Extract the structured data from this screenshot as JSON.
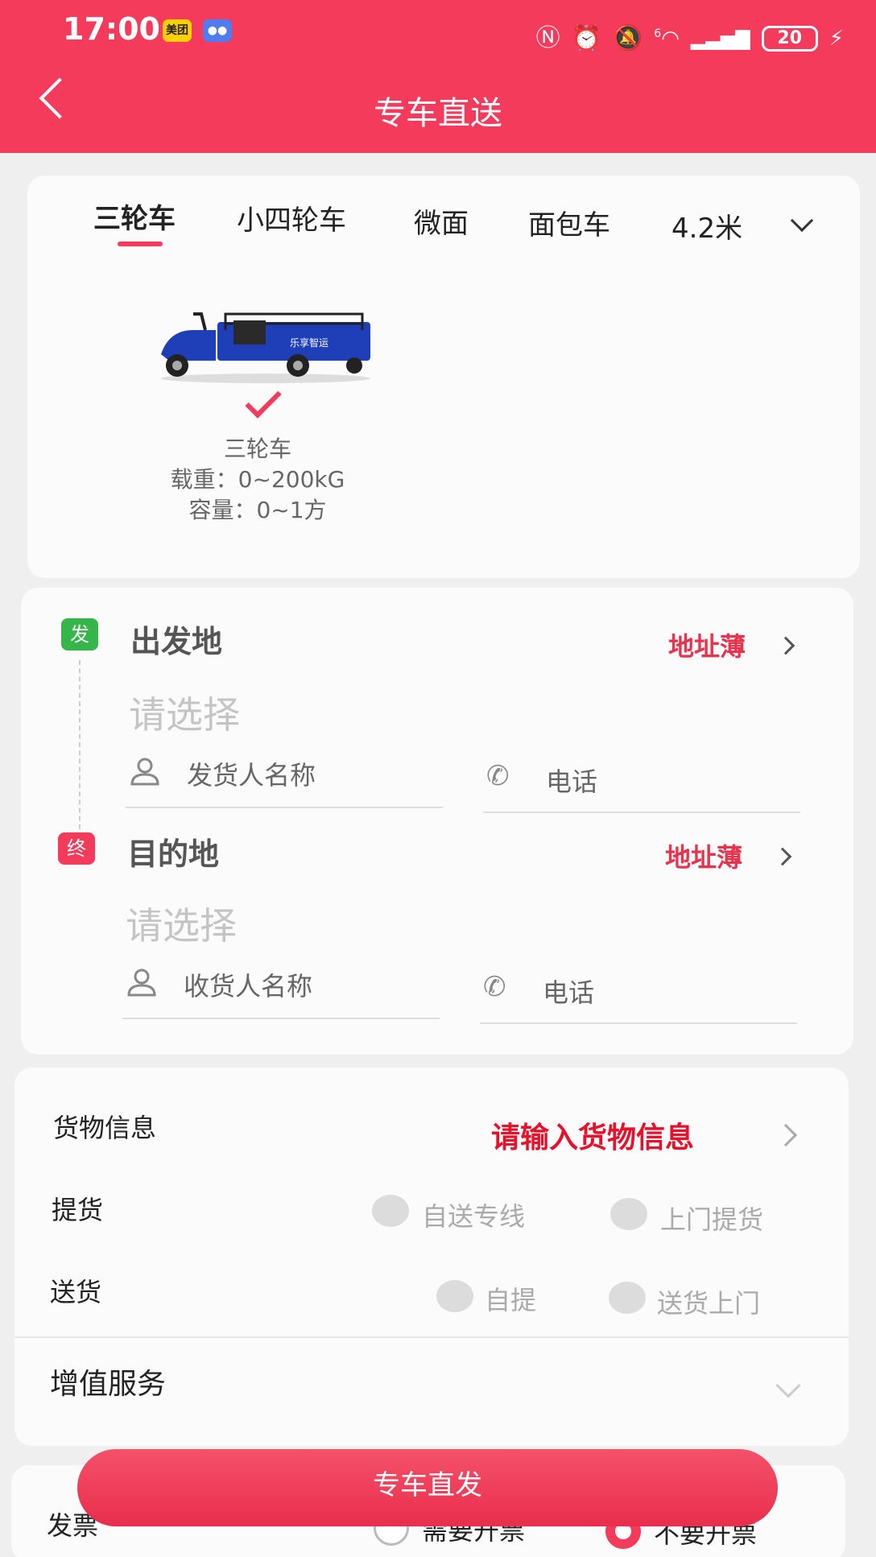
{
  "status_bar": {
    "time": "17:00",
    "app_icon_1": "美团",
    "app_icon_2": "chat-bubble",
    "battery": "20",
    "signal_label": "6"
  },
  "header": {
    "title": "专车直送"
  },
  "vehicle_tabs": [
    {
      "label": "三轮车",
      "active": true
    },
    {
      "label": "小四轮车",
      "active": false
    },
    {
      "label": "微面",
      "active": false
    },
    {
      "label": "面包车",
      "active": false
    },
    {
      "label": "4.2米",
      "active": false
    }
  ],
  "vehicle": {
    "name": "三轮车",
    "load": "载重：0~200kG",
    "capacity": "容量：0~1方",
    "image_text": "乐享智运"
  },
  "origin": {
    "badge": "发",
    "title": "出发地",
    "address_book": "地址薄",
    "placeholder": "请选择",
    "name_placeholder": "发货人名称",
    "phone_placeholder": "电话"
  },
  "destination": {
    "badge": "终",
    "title": "目的地",
    "address_book": "地址薄",
    "placeholder": "请选择",
    "name_placeholder": "收货人名称",
    "phone_placeholder": "电话"
  },
  "cargo": {
    "label": "货物信息",
    "link": "请输入货物信息"
  },
  "pickup": {
    "label": "提货",
    "options": [
      "自送专线",
      "上门提货"
    ]
  },
  "delivery": {
    "label": "送货",
    "options": [
      "自提",
      "送货上门"
    ]
  },
  "value_added": {
    "label": "增值服务"
  },
  "submit": {
    "label": "专车直发"
  },
  "invoice": {
    "label": "发票",
    "options": [
      "需要开票",
      "不要开票"
    ],
    "selected": "不要开票"
  },
  "colors": {
    "accent": "#f43b5b",
    "origin_badge": "#36b64a",
    "dest_badge": "#f43b5b"
  }
}
